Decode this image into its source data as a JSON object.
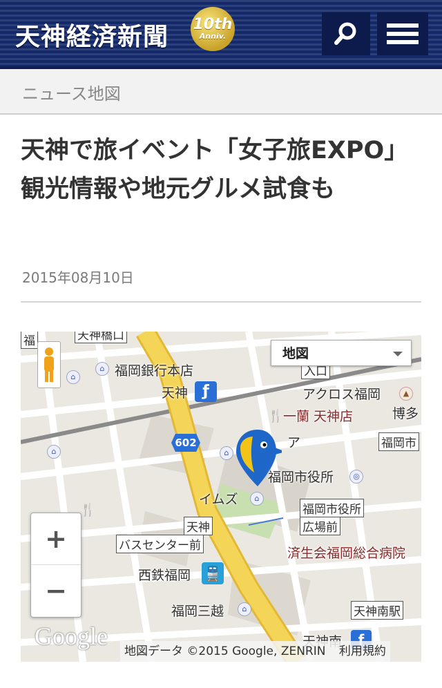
{
  "header": {
    "logo": "天神経済新聞",
    "badge_num": "10th",
    "badge_sub": "Anniv.",
    "search_icon": "search-icon",
    "menu_icon": "hamburger-menu-icon"
  },
  "breadcrumb": "ニュース地図",
  "article": {
    "title": "天神で旅イベント「女子旅EXPO」　観光情報や地元グルメ試食も",
    "date": "2015年08月10日"
  },
  "map": {
    "map_type": "地図",
    "zoom_in": "+",
    "zoom_out": "−",
    "google": "Google",
    "attribution": "地図データ ©2015 Google, ZENRIN",
    "terms": "利用規約",
    "road_number": "602",
    "labels": {
      "bank": "福岡銀行本店",
      "tenjin": "天神",
      "acros": "アクロス福岡",
      "ichiran": "一蘭 天神店",
      "hakata": "博多",
      "city_hall": "福岡市役所",
      "city_hall_short": "福岡市",
      "imz": "イムズ",
      "bus_center_1": "天神",
      "bus_center_2": "バスセンター前",
      "cityhall_stop_1": "福岡市役所",
      "cityhall_stop_2": "広場前",
      "hospital": "済生会福岡総合病院",
      "nishitetsu": "西鉄福岡",
      "mitsukoshi": "福岡三越",
      "tenjin_minami_station": "天神南駅",
      "tenjin_minami": "天神南",
      "tenjin_kita_box": "天神橋口",
      "a": "ア",
      "fuku": "福",
      "fuku_box": "福",
      "oiri": "入口"
    }
  }
}
